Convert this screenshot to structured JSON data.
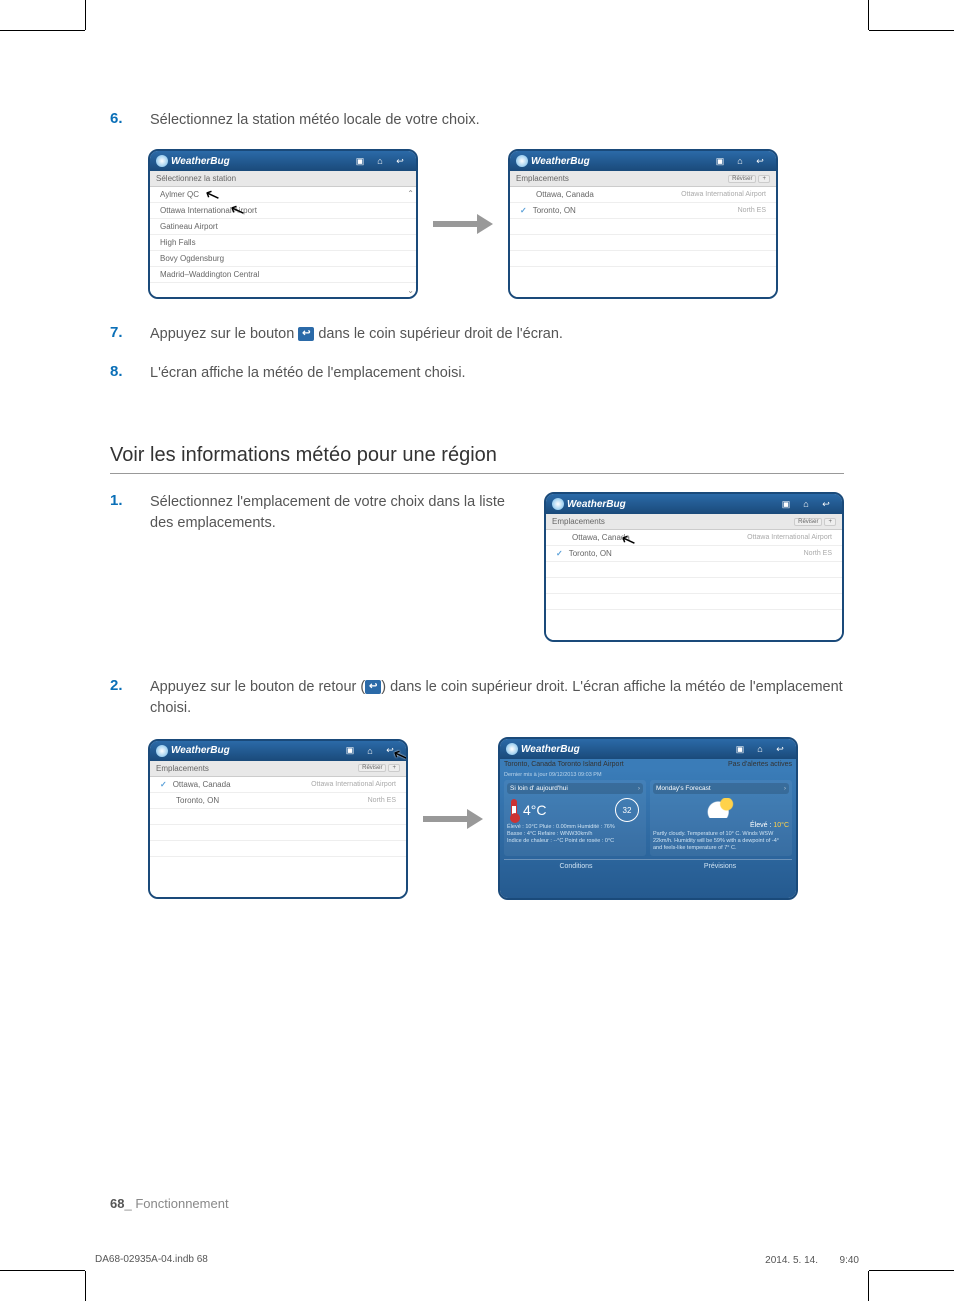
{
  "steps_a": [
    {
      "num": "6.",
      "text": "Sélectionnez la station météo locale de votre choix."
    },
    {
      "num": "7.",
      "text_before": "Appuyez sur le bouton ",
      "icon": "return-icon",
      "text_after": " dans le coin supérieur droit de l'écran."
    },
    {
      "num": "8.",
      "text": "L'écran affiche la météo de l'emplacement choisi."
    }
  ],
  "section_heading": "Voir les informations météo pour une région",
  "steps_b": [
    {
      "num": "1.",
      "text": "Sélectionnez l'emplacement de votre choix dans la liste des emplacements."
    },
    {
      "num": "2.",
      "text_before": "Appuyez sur le bouton de retour (",
      "icon": "return-icon",
      "text_after": ") dans le coin supérieur droit. L'écran affiche la météo de l'emplacement choisi."
    }
  ],
  "brand": "WeatherBug",
  "shot1": {
    "subheader": "Sélectionnez la station",
    "items": [
      "Aylmer QC",
      "Ottawa International Airport",
      "Gatineau Airport",
      "High Falls",
      "Bovy Ogdensburg",
      "Madrid–Waddington Central"
    ]
  },
  "shot_loc": {
    "subheader": "Emplacements",
    "revise": "Réviser",
    "plus": "+",
    "rows": [
      {
        "city": "Ottawa, Canada",
        "station": "Ottawa International Airport",
        "checked": false
      },
      {
        "city": "Toronto, ON",
        "station": "North ES",
        "checked": true
      }
    ]
  },
  "weather": {
    "location": "Toronto, Canada Toronto Island Airport",
    "no_alerts": "Pas d'alertes actives",
    "updated": "Dernier mis à jour 09/12/2013 09:03 PM",
    "left_title": "Si loin d' aujourd'hui",
    "temp": "4°C",
    "uv": "32",
    "high_label": "Élevé",
    "high_val": "10°C",
    "rain_label": "Pluie",
    "rain_val": "0.00mm",
    "humid_label": "Humidité",
    "humid_val": "76%",
    "low_label": "Basse",
    "low_val": "4°C",
    "refr_label": "Refaire",
    "refr_val": "WNW30km/h",
    "heat_label": "Indice de chaleur",
    "heat_val": "--°C",
    "dew_label": "Point de rosée",
    "dew_val": "0°C",
    "right_title": "Monday's Forecast",
    "forecast_label": "Élevé",
    "forecast_val": "10°C",
    "forecast_text": "Partly cloudy. Temperature of 10° C. Winds WSW 22km/h. Humidity will be 59% with a dewpoint of -4° and feels-like temperature of 7° C.",
    "tab_conditions": "Conditions",
    "tab_forecast": "Prévisions"
  },
  "footer": {
    "page": "68",
    "sep": "_",
    "label": "Fonctionnement"
  },
  "print": {
    "file": "DA68-02935A-04.indb   68",
    "stamp": "2014. 5. 14.    9:40"
  }
}
